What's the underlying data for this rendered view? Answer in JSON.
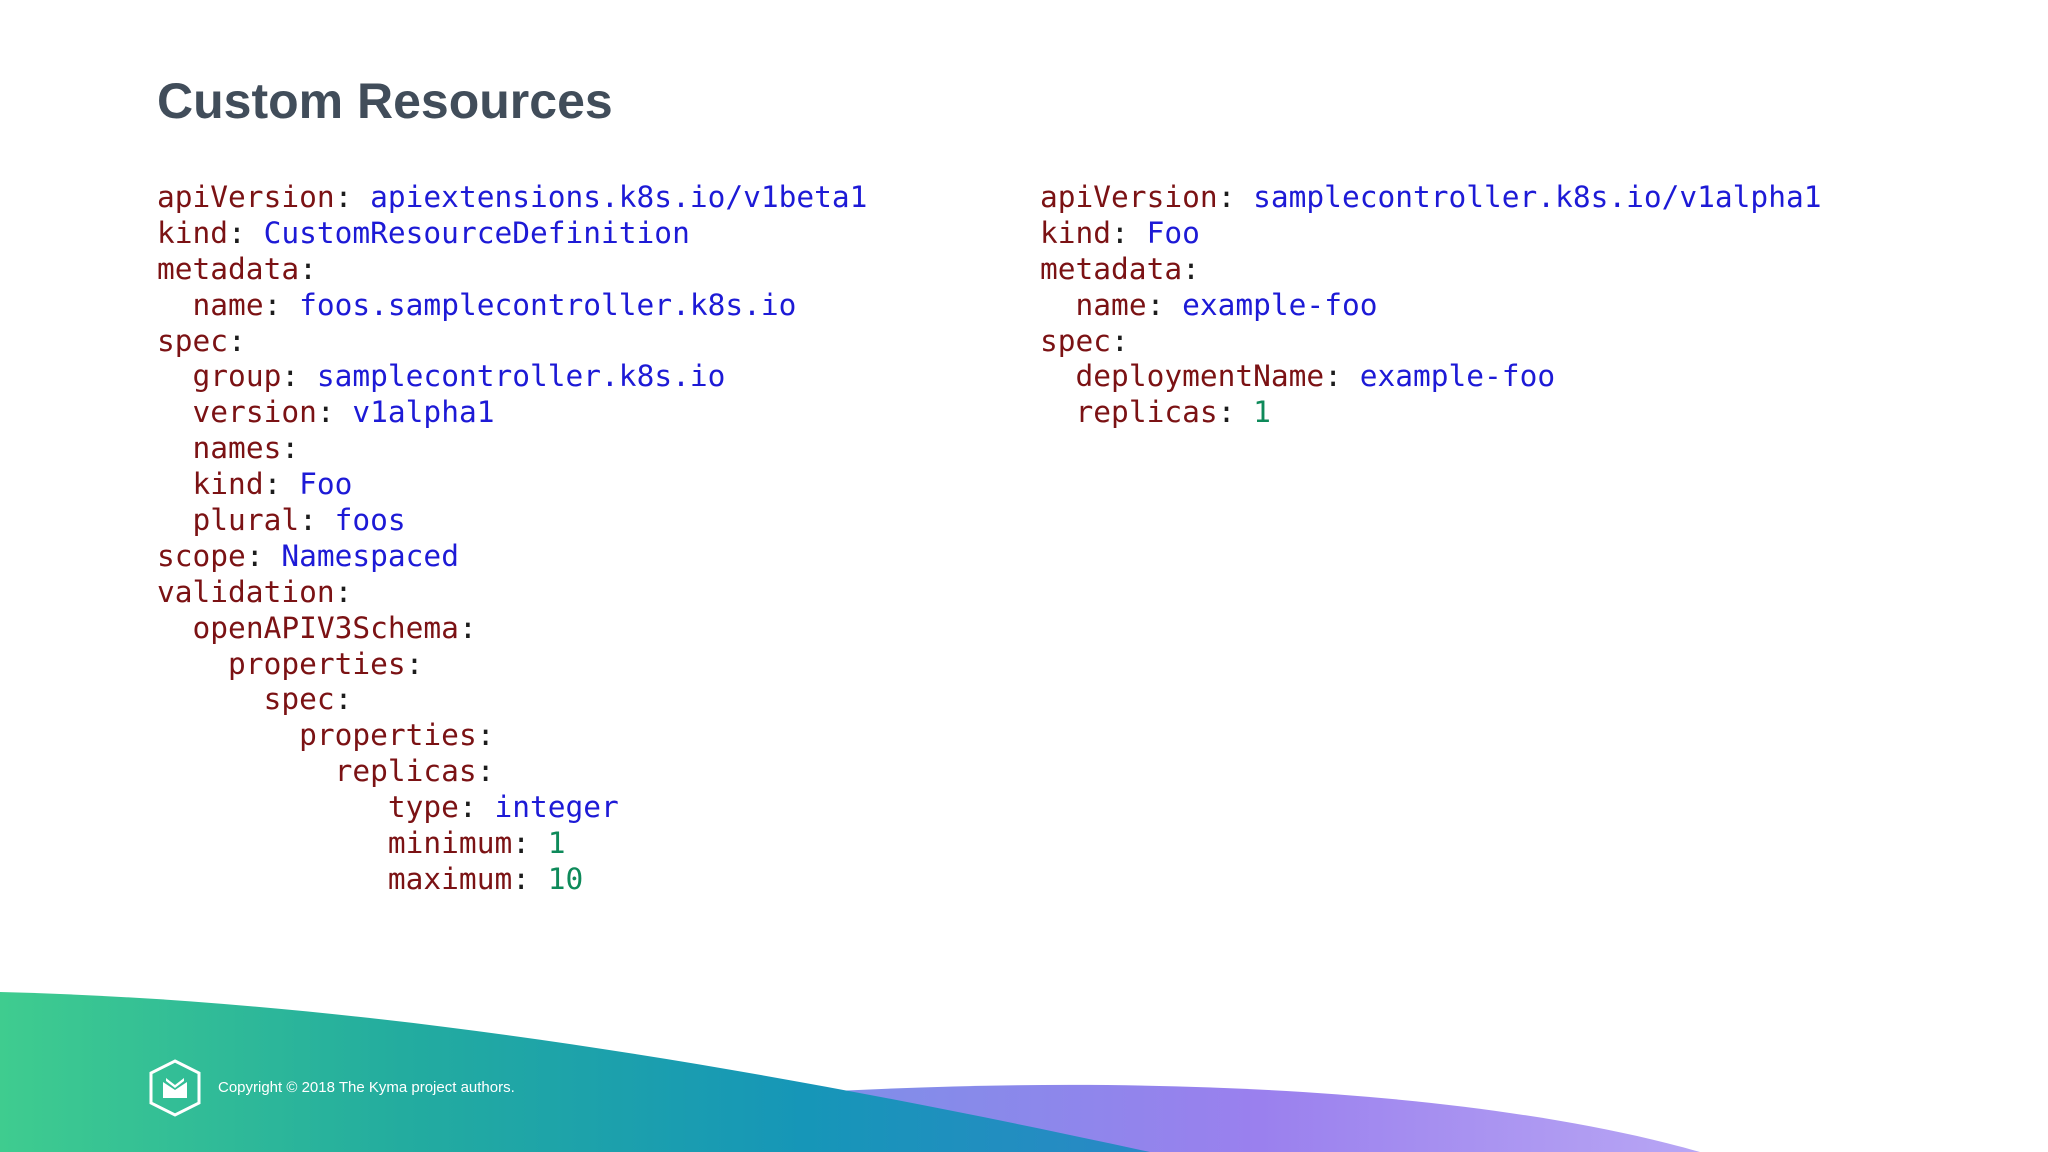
{
  "title": "Custom Resources",
  "code_left": [
    {
      "indent": "",
      "key": "apiVersion",
      "value": "apiextensions.k8s.io/v1beta1",
      "vtype": "s"
    },
    {
      "indent": "",
      "key": "kind",
      "value": "CustomResourceDefinition",
      "vtype": "s"
    },
    {
      "indent": "",
      "key": "metadata",
      "value": "",
      "vtype": "s"
    },
    {
      "indent": "  ",
      "key": "name",
      "value": "foos.samplecontroller.k8s.io",
      "vtype": "s"
    },
    {
      "indent": "",
      "key": "spec",
      "value": "",
      "vtype": "s"
    },
    {
      "indent": "  ",
      "key": "group",
      "value": "samplecontroller.k8s.io",
      "vtype": "s"
    },
    {
      "indent": "  ",
      "key": "version",
      "value": "v1alpha1",
      "vtype": "s"
    },
    {
      "indent": "  ",
      "key": "names",
      "value": "",
      "vtype": "s"
    },
    {
      "indent": "  ",
      "key": "kind",
      "value": "Foo",
      "vtype": "s"
    },
    {
      "indent": "  ",
      "key": "plural",
      "value": "foos",
      "vtype": "s"
    },
    {
      "indent": "",
      "key": "scope",
      "value": "Namespaced",
      "vtype": "s"
    },
    {
      "indent": "",
      "key": "validation",
      "value": "",
      "vtype": "s"
    },
    {
      "indent": "  ",
      "key": "openAPIV3Schema",
      "value": "",
      "vtype": "s"
    },
    {
      "indent": "    ",
      "key": "properties",
      "value": "",
      "vtype": "s"
    },
    {
      "indent": "      ",
      "key": "spec",
      "value": "",
      "vtype": "s"
    },
    {
      "indent": "        ",
      "key": "properties",
      "value": "",
      "vtype": "s"
    },
    {
      "indent": "          ",
      "key": "replicas",
      "value": "",
      "vtype": "s"
    },
    {
      "indent": "             ",
      "key": "type",
      "value": "integer",
      "vtype": "s"
    },
    {
      "indent": "             ",
      "key": "minimum",
      "value": "1",
      "vtype": "n"
    },
    {
      "indent": "             ",
      "key": "maximum",
      "value": "10",
      "vtype": "n"
    }
  ],
  "code_right": [
    {
      "indent": "",
      "key": "apiVersion",
      "value": "samplecontroller.k8s.io/v1alpha1",
      "vtype": "s"
    },
    {
      "indent": "",
      "key": "kind",
      "value": "Foo",
      "vtype": "s"
    },
    {
      "indent": "",
      "key": "metadata",
      "value": "",
      "vtype": "s"
    },
    {
      "indent": "  ",
      "key": "name",
      "value": "example-foo",
      "vtype": "s"
    },
    {
      "indent": "",
      "key": "spec",
      "value": "",
      "vtype": "s"
    },
    {
      "indent": "  ",
      "key": "deploymentName",
      "value": "example-foo",
      "vtype": "s"
    },
    {
      "indent": "  ",
      "key": "replicas",
      "value": "1",
      "vtype": "n"
    }
  ],
  "footer": {
    "copyright": "Copyright © 2018 The Kyma project authors.",
    "logo_icon": "kyma-logo-icon"
  },
  "colors": {
    "title": "#414d5a",
    "key": "#7b1214",
    "string_value": "#1d1ad6",
    "number_value": "#0e8a5a",
    "wave_green": "#3ecf8e",
    "wave_teal": "#1aa3b0",
    "wave_purple": "#9a80ee"
  }
}
